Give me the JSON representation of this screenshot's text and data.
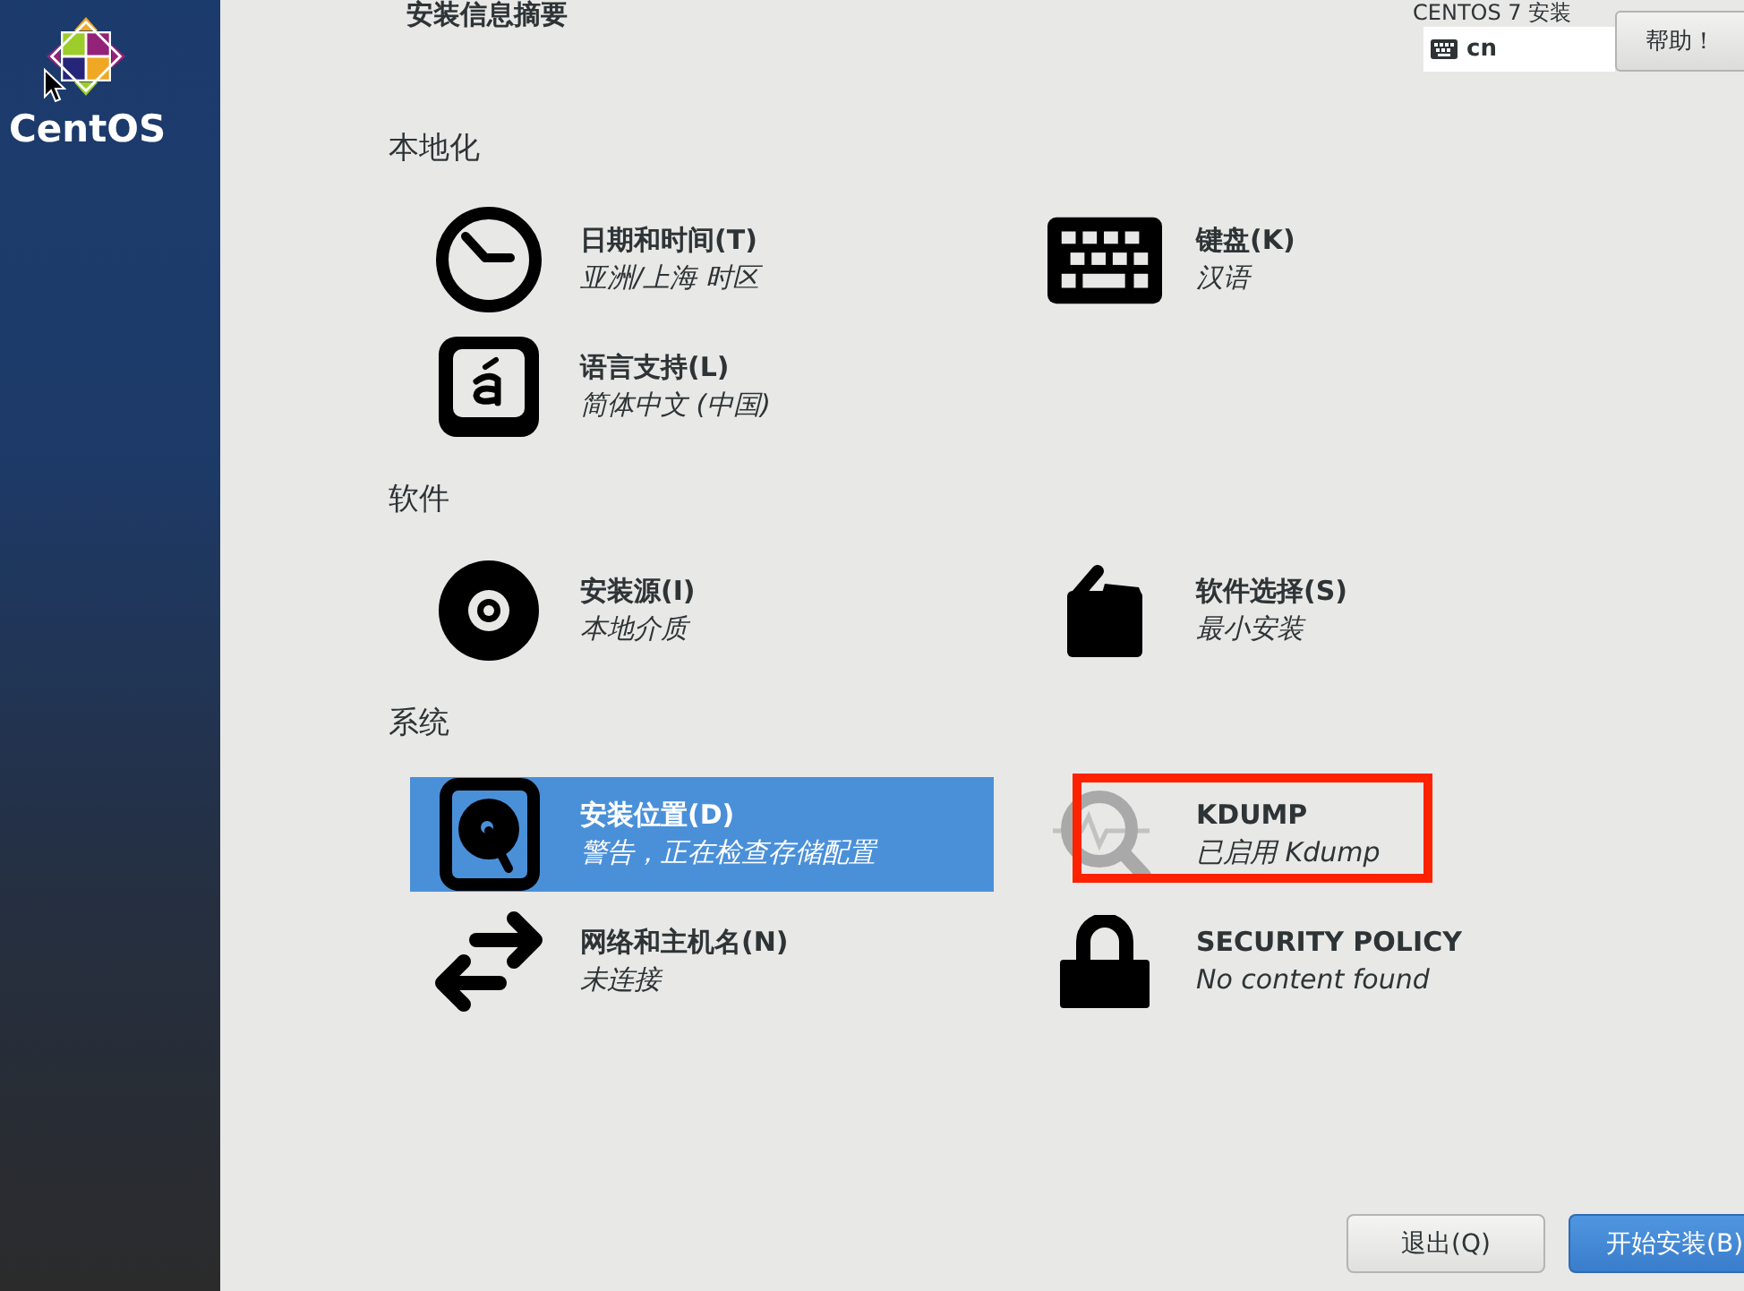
{
  "sidebar": {
    "logo_text": "CentOS"
  },
  "header": {
    "title": "安装信息摘要",
    "product": "CENTOS 7 安装",
    "keyboard_layout": "cn",
    "help_button": "帮助！"
  },
  "sections": [
    {
      "title": "本地化",
      "items": [
        {
          "title": "日期和时间(T)",
          "status": "亚洲/上海 时区",
          "selected": false,
          "highlighted": false,
          "icon_dimmed": false
        },
        {
          "title": "键盘(K)",
          "status": "汉语",
          "selected": false,
          "highlighted": false,
          "icon_dimmed": false
        },
        {
          "title": "语言支持(L)",
          "status": "简体中文 (中国)",
          "selected": false,
          "highlighted": false,
          "icon_dimmed": false
        }
      ]
    },
    {
      "title": "软件",
      "items": [
        {
          "title": "安装源(I)",
          "status": "本地介质",
          "selected": false,
          "highlighted": false,
          "icon_dimmed": false
        },
        {
          "title": "软件选择(S)",
          "status": "最小安装",
          "selected": false,
          "highlighted": false,
          "icon_dimmed": false
        }
      ]
    },
    {
      "title": "系统",
      "items": [
        {
          "title": "安装位置(D)",
          "status": "警告，正在检查存储配置",
          "selected": true,
          "highlighted": false,
          "icon_dimmed": false
        },
        {
          "title": "KDUMP",
          "status": "已启用 Kdump",
          "selected": false,
          "highlighted": true,
          "icon_dimmed": true
        },
        {
          "title": "网络和主机名(N)",
          "status": "未连接",
          "selected": false,
          "highlighted": false,
          "icon_dimmed": false
        },
        {
          "title": "SECURITY POLICY",
          "status": "No content found",
          "selected": false,
          "highlighted": false,
          "icon_dimmed": false
        }
      ]
    }
  ],
  "buttons": [
    {
      "label": "退出(Q)",
      "kind": "secondary"
    },
    {
      "label": "开始安装(B)",
      "kind": "primary"
    }
  ]
}
